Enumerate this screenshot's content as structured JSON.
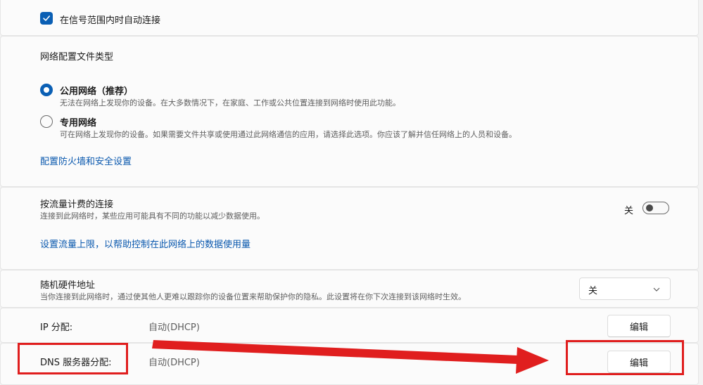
{
  "auto_connect": {
    "label": "在信号范围内时自动连接",
    "checked": true
  },
  "profile": {
    "heading": "网络配置文件类型",
    "public": {
      "label": "公用网络（推荐）",
      "desc": "无法在网络上发现你的设备。在大多数情况下，在家庭、工作或公共位置连接到网络时使用此功能。",
      "selected": true
    },
    "private": {
      "label": "专用网络",
      "desc": "可在网络上发现你的设备。如果需要文件共享或使用通过此网络通信的应用，请选择此选项。你应该了解并信任网络上的人员和设备。",
      "selected": false
    },
    "firewall_link": "配置防火墙和安全设置"
  },
  "metered": {
    "title": "按流量计费的连接",
    "desc": "连接到此网络时，某些应用可能具有不同的功能以减少数据使用。",
    "state": "关",
    "limit_link": "设置流量上限，以帮助控制在此网络上的数据使用量"
  },
  "random_mac": {
    "title": "随机硬件地址",
    "desc": "当你连接到此网络时，通过使其他人更难以跟踪你的设备位置来帮助保护你的隐私。此设置将在你下次连接到该网络时生效。",
    "value": "关"
  },
  "ip": {
    "label": "IP 分配:",
    "value": "自动(DHCP)",
    "button": "编辑"
  },
  "dns": {
    "label": "DNS 服务器分配:",
    "value": "自动(DHCP)",
    "button": "编辑"
  },
  "colors": {
    "accent": "#0a5fb4",
    "link": "#0a58ae",
    "annotation": "#e01e1e"
  }
}
